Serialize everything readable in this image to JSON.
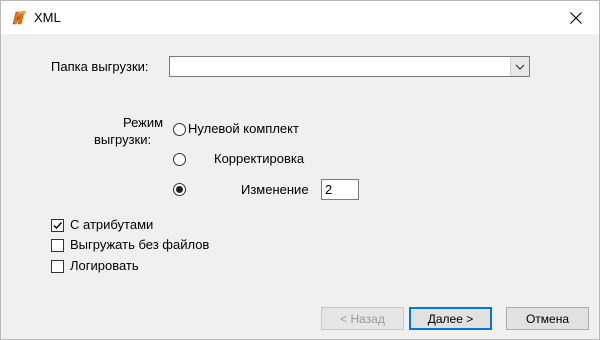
{
  "window": {
    "title": "XML",
    "icon": "app-icon-orange-s",
    "close_icon": "close-icon"
  },
  "form": {
    "folder_label": "Папка выгрузки:",
    "folder_value": "",
    "mode_label_line1": "Режим",
    "mode_label_line2": "выгрузки:",
    "modes": [
      {
        "label": "Нулевой комплект",
        "selected": false
      },
      {
        "label": "Корректировка",
        "selected": false
      },
      {
        "label": "Изменение",
        "selected": true
      }
    ],
    "change_value": "2",
    "options": [
      {
        "label": "С атрибутами",
        "checked": true
      },
      {
        "label": "Выгружать без файлов",
        "checked": false
      },
      {
        "label": "Логировать",
        "checked": false
      }
    ]
  },
  "buttons": {
    "back": "< Назад",
    "next": "Далее >",
    "cancel": "Отмена"
  },
  "colors": {
    "background": "#f0f0f0",
    "titlebar": "#ffffff",
    "default_button_border": "#0078d7",
    "app_icon": "#e8741a"
  }
}
